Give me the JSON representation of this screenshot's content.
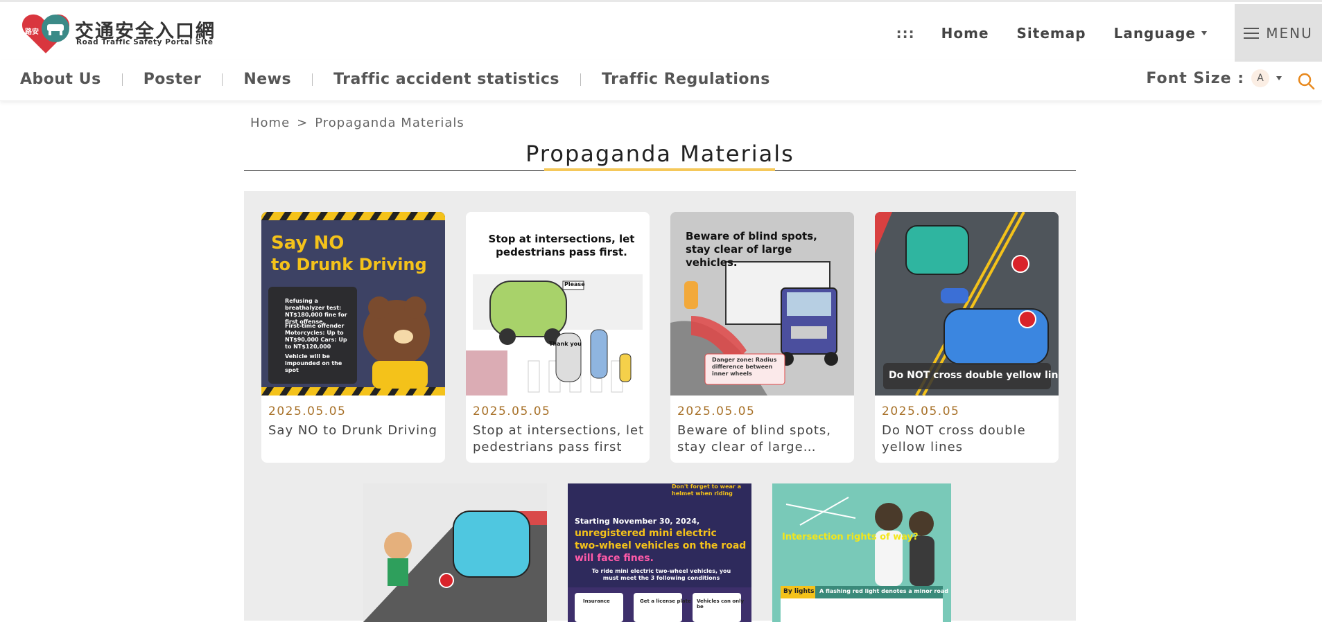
{
  "header": {
    "logo_cn": "交通安全入口網",
    "logo_en": "Road Traffic Safety Portal Site",
    "accesskey": ":::",
    "home": "Home",
    "sitemap": "Sitemap",
    "language": "Language",
    "menu": "MENU"
  },
  "nav": {
    "items": [
      "About Us",
      "Poster",
      "News",
      "Traffic accident statistics",
      "Traffic Regulations"
    ],
    "font_size_label": "Font Size :",
    "font_size_value": "A"
  },
  "breadcrumb": {
    "home": "Home",
    "separator": ">",
    "current": "Propaganda Materials"
  },
  "page": {
    "title": "Propaganda Materials"
  },
  "cards": [
    {
      "date": "2025.05.05",
      "title": "Say NO to Drunk Driving",
      "img_title1": "Say NO",
      "img_title2": "to Drunk Driving",
      "img_b1": "Refusing a breathalyzer test: NT$180,000 fine for first offense.",
      "img_b2": "First-time offender Motorcycles: Up to NT$90,000 Cars: Up to NT$120,000",
      "img_b3": "Vehicle will be impounded on the spot"
    },
    {
      "date": "2025.05.05",
      "title": "Stop at intersections, let pedestrians pass first",
      "img_title": "Stop at intersections, let pedestrians pass first.",
      "img_please": "Please",
      "img_thanks": "Thank you"
    },
    {
      "date": "2025.05.05",
      "title": "Beware of blind spots, stay clear of large…",
      "img_title": "Beware of blind spots, stay clear of large vehicles.",
      "img_danger": "Danger zone: Radius difference between inner wheels"
    },
    {
      "date": "2025.05.05",
      "title": "Do NOT cross double yellow lines",
      "img_caption": "Do NOT cross double yellow lines"
    }
  ],
  "bottom_cards": [
    {},
    {
      "img_tag": "Don't forget to wear a helmet when riding",
      "img_l1": "Starting November 30, 2024,",
      "img_l2": "unregistered mini electric",
      "img_l3": "two-wheel vehicles on the road",
      "img_l4": "will face fines.",
      "img_l5": "To ride mini electric two-wheel vehicles, you must meet the 3 following conditions",
      "img_c1": "Insurance",
      "img_c2": "Get a license plate",
      "img_c3": "Vehicles can only be"
    },
    {
      "img_title": "Intersection rights of way?",
      "img_sub": "By lights",
      "img_note": "A flashing red light denotes a minor road"
    }
  ],
  "colors": {
    "accent": "#f5c85a",
    "date": "#a8722a",
    "panel": "#ececec",
    "logo_red": "#d9363e",
    "logo_teal": "#3b8a87"
  }
}
